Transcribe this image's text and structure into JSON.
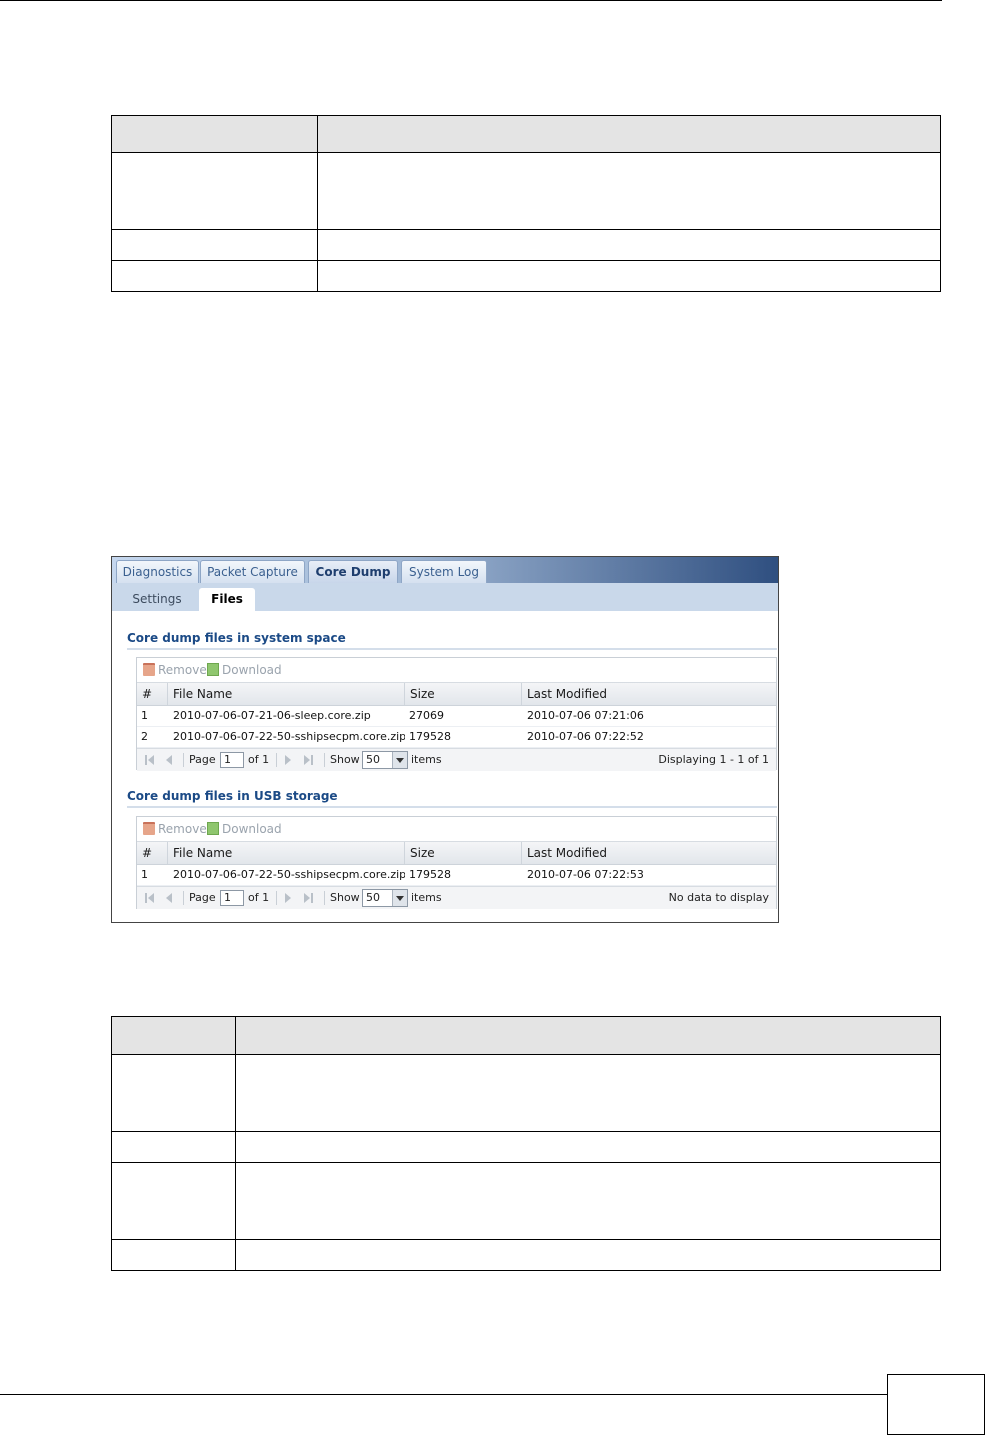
{
  "screenshot": {
    "tabs": [
      "Diagnostics",
      "Packet Capture",
      "Core Dump",
      "System Log"
    ],
    "subtabs": [
      "Settings",
      "Files"
    ],
    "sections": [
      {
        "title": "Core dump files in system space",
        "toolbar": {
          "remove": "Remove",
          "download": "Download"
        },
        "columns": [
          "#",
          "File Name",
          "Size",
          "Last Modified"
        ],
        "rows": [
          {
            "index": "1",
            "file": "2010-07-06-07-21-06-sleep.core.zip",
            "size": "27069",
            "modified": "2010-07-06 07:21:06"
          },
          {
            "index": "2",
            "file": "2010-07-06-07-22-50-sshipsecpm.core.zip",
            "size": "179528",
            "modified": "2010-07-06 07:22:52"
          }
        ],
        "pager": {
          "page_label": "Page",
          "page_value": "1",
          "of": "of 1",
          "show": "Show",
          "per_page": "50",
          "items": "items",
          "status": "Displaying 1 - 1 of 1"
        }
      },
      {
        "title": "Core dump files in USB storage",
        "toolbar": {
          "remove": "Remove",
          "download": "Download"
        },
        "columns": [
          "#",
          "File Name",
          "Size",
          "Last Modified"
        ],
        "rows": [
          {
            "index": "1",
            "file": "2010-07-06-07-22-50-sshipsecpm.core.zip",
            "size": "179528",
            "modified": "2010-07-06 07:22:53"
          }
        ],
        "pager": {
          "page_label": "Page",
          "page_value": "1",
          "of": "of 1",
          "show": "Show",
          "per_page": "50",
          "items": "items",
          "status": "No data to display"
        }
      }
    ]
  }
}
